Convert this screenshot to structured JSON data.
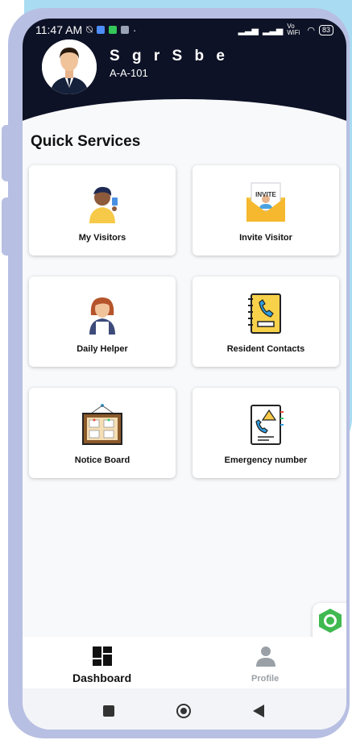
{
  "status_bar": {
    "time": "11:47 AM",
    "vowifi": "Vo WiFi",
    "battery": "83"
  },
  "user": {
    "name": "S g r S b e",
    "unit": "A-A-101"
  },
  "section_title": "Quick Services",
  "services": [
    {
      "label": "My Visitors",
      "icon": "visitor-icon"
    },
    {
      "label": "Invite Visitor",
      "icon": "invite-icon",
      "badge": "INVITE"
    },
    {
      "label": "Daily Helper",
      "icon": "helper-icon"
    },
    {
      "label": "Resident Contacts",
      "icon": "contacts-book-icon"
    },
    {
      "label": "Notice Board",
      "icon": "notice-board-icon"
    },
    {
      "label": "Emergency number",
      "icon": "emergency-icon"
    }
  ],
  "bottom_nav": {
    "dashboard": "Dashboard",
    "profile": "Profile"
  },
  "colors": {
    "header": "#0d1226",
    "frame": "#b7bfe2",
    "background_accent": "#a9dcf2",
    "fab_green": "#3fb950",
    "fab_orange": "#f5a623"
  }
}
